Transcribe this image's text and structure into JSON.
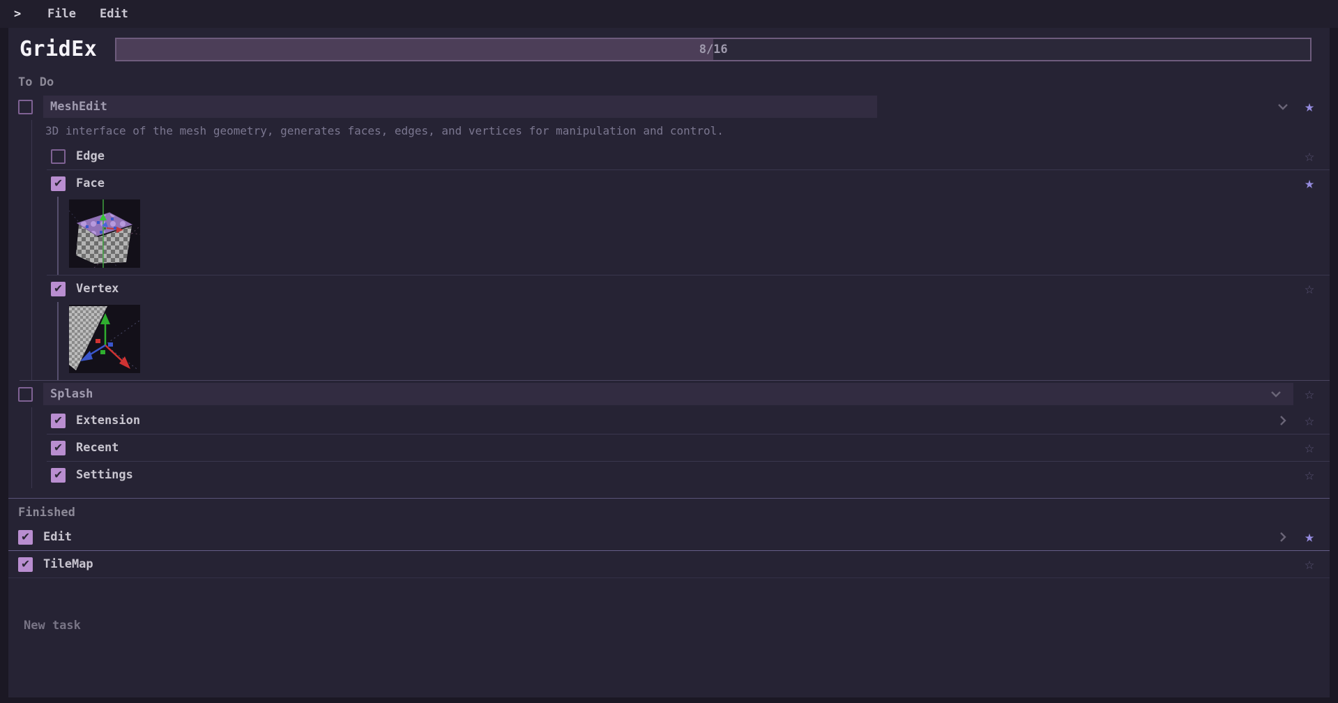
{
  "icons": {
    "menu_chevron": ">",
    "star_filled": "★",
    "star_outline": "☆",
    "checkbox_check": "✔"
  },
  "menu_bar": {
    "items": [
      {
        "label": "File"
      },
      {
        "label": "Edit"
      }
    ]
  },
  "header": {
    "title": "GridEx",
    "progress": {
      "label": "8/16",
      "completed": 8,
      "total": 16,
      "percent": 50
    }
  },
  "sections": {
    "todo": "To Do",
    "finished": "Finished"
  },
  "tasks": {
    "meshedit": {
      "title": "MeshEdit",
      "checked": false,
      "starred": true,
      "description": "3D interface of the mesh geometry, generates faces, edges, and vertices for manipulation and control.",
      "subtasks": {
        "edge": {
          "label": "Edge",
          "checked": false,
          "starred": false
        },
        "face": {
          "label": "Face",
          "checked": true,
          "starred": true,
          "thumbnail": "3d-cube-mesh-viewport"
        },
        "vertex": {
          "label": "Vertex",
          "checked": true,
          "starred": false,
          "thumbnail": "3d-plane-axis-gizmo-viewport"
        }
      }
    },
    "splash": {
      "title": "Splash",
      "checked": false,
      "starred": false,
      "subtasks": {
        "extension": {
          "label": "Extension",
          "checked": true,
          "starred": false
        },
        "recent": {
          "label": "Recent",
          "checked": true,
          "starred": false
        },
        "settings": {
          "label": "Settings",
          "checked": true,
          "starred": false
        }
      }
    },
    "edit": {
      "title": "Edit",
      "checked": true,
      "starred": true
    },
    "tilemap": {
      "title": "TileMap",
      "checked": true,
      "starred": false
    }
  },
  "footer": {
    "new_task_placeholder": "New task"
  },
  "colors": {
    "accent_checkbox": "#b98ed0",
    "star_active": "#968ce0",
    "progress_fill": "#4c3e58",
    "app_background": "#262334"
  }
}
